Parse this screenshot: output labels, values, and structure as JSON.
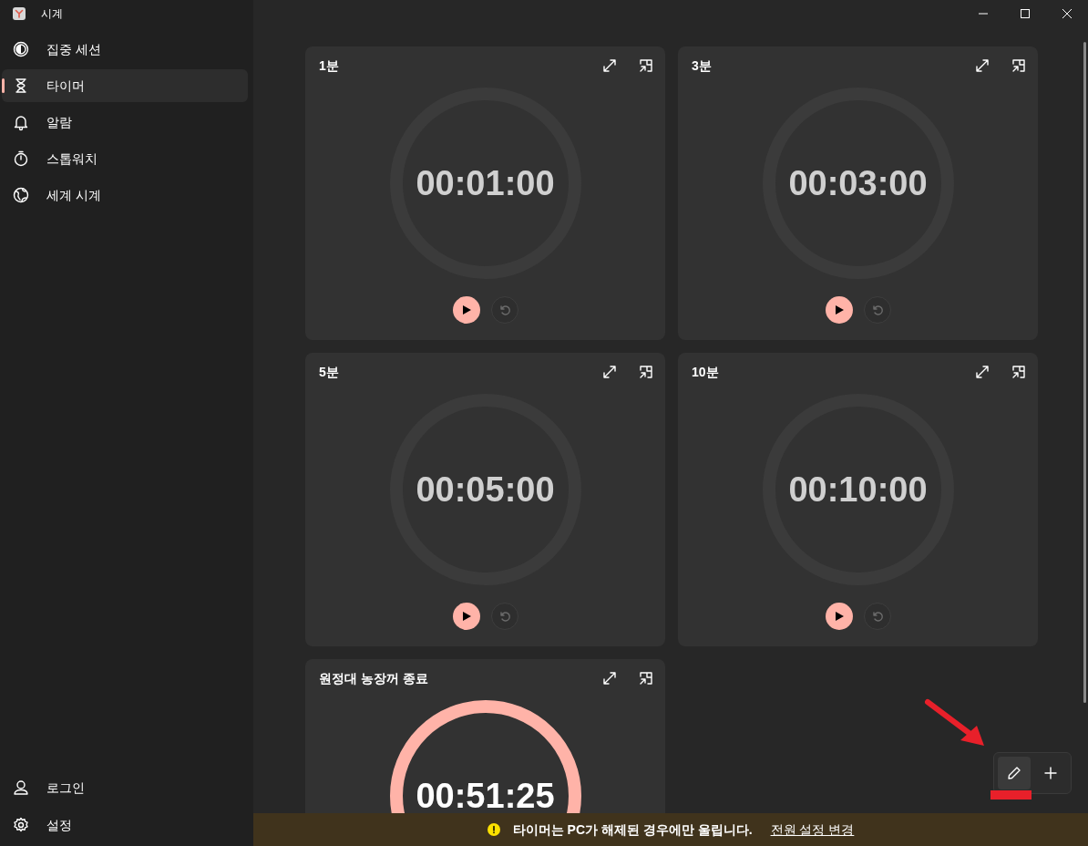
{
  "window": {
    "title": "시계"
  },
  "sidebar": {
    "items": [
      {
        "label": "집중 세션",
        "selected": false
      },
      {
        "label": "타이머",
        "selected": true
      },
      {
        "label": "알람",
        "selected": false
      },
      {
        "label": "스톱워치",
        "selected": false
      },
      {
        "label": "세계 시계",
        "selected": false
      }
    ],
    "footer_items": [
      {
        "label": "로그인"
      },
      {
        "label": "설정"
      }
    ]
  },
  "timers": [
    {
      "title": "1분",
      "time": "00:01:00",
      "active": false
    },
    {
      "title": "3분",
      "time": "00:03:00",
      "active": false
    },
    {
      "title": "5분",
      "time": "00:05:00",
      "active": false
    },
    {
      "title": "10분",
      "time": "00:10:00",
      "active": false
    },
    {
      "title": "원정대 농장꺼 종료",
      "time": "00:51:25",
      "active": true
    }
  ],
  "banner": {
    "message": "타이머는 PC가 해제된 경우에만 울립니다.",
    "link": "전원 설정 변경"
  }
}
